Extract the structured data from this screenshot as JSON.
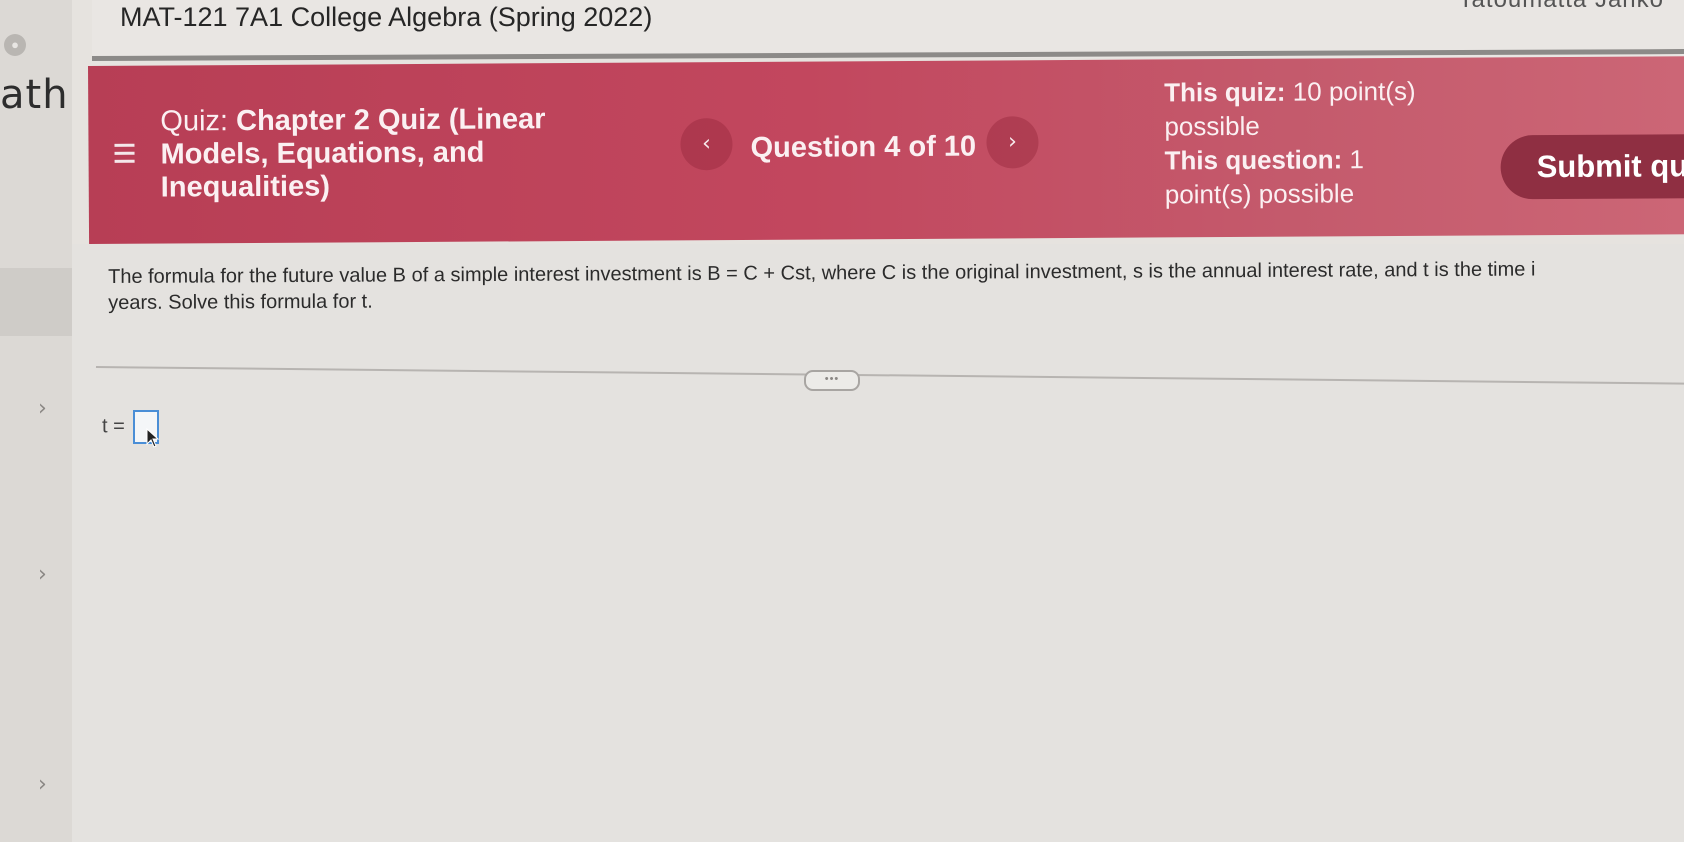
{
  "course": {
    "title": "MAT-121 7A1 College Algebra (Spring 2022)",
    "user_fragment": "Tatoumatta Janko"
  },
  "sidebar": {
    "fragment_text": "ath",
    "logo_glyph": "●",
    "chevrons": [
      "›",
      "›",
      "›"
    ]
  },
  "quiz_header": {
    "title_prefix": "Quiz:",
    "title": "Chapter 2 Quiz (Linear Models, Equations, and Inequalities)",
    "question_counter": "Question 4 of 10",
    "prev_icon": "‹",
    "next_icon": "›",
    "quiz_points_label": "This quiz:",
    "quiz_points_value": "10 point(s) possible",
    "question_points_label": "This question:",
    "question_points_value": "1 point(s) possible",
    "submit_label": "Submit qu",
    "background_color": "#bf4a60"
  },
  "question": {
    "text_line1": "The formula for the future value B of a simple interest investment is B = C + Cst, where C is the original investment, s is the annual interest rate, and t is the time i",
    "text_line2": "years. Solve this formula for t.",
    "expand_label": "•••"
  },
  "answer": {
    "label": "t =",
    "value": ""
  }
}
